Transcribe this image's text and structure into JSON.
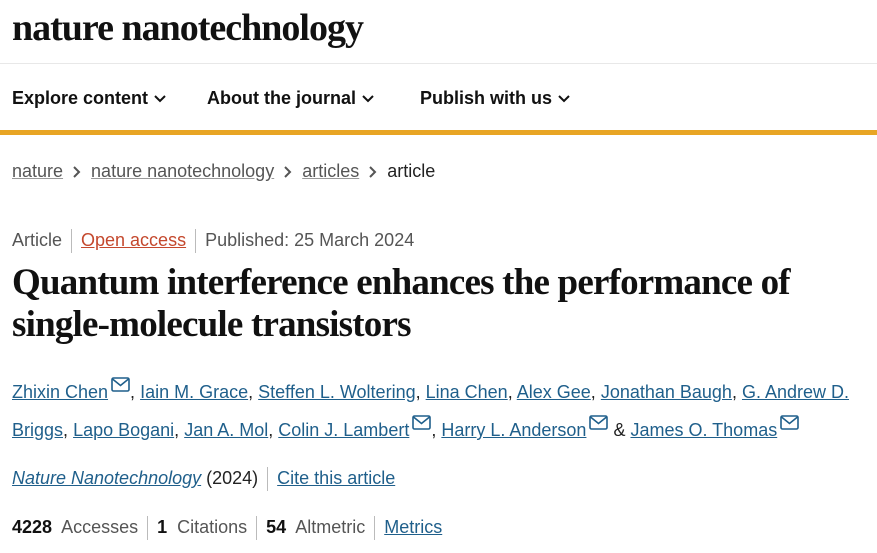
{
  "header": {
    "logo": "nature nanotechnology"
  },
  "nav": {
    "items": [
      {
        "label": "Explore content"
      },
      {
        "label": "About the journal"
      },
      {
        "label": "Publish with us"
      }
    ]
  },
  "breadcrumb": {
    "items": [
      "nature",
      "nature nanotechnology",
      "articles",
      "article"
    ]
  },
  "article_meta": {
    "type": "Article",
    "access": "Open access",
    "published": "Published: 25 March 2024"
  },
  "title": "Quantum interference enhances the performance of single-molecule transistors",
  "authors": [
    {
      "name": "Zhixin Chen",
      "mail": true
    },
    {
      "name": "Iain M. Grace",
      "mail": false
    },
    {
      "name": "Steffen L. Woltering",
      "mail": false
    },
    {
      "name": "Lina Chen",
      "mail": false
    },
    {
      "name": "Alex Gee",
      "mail": false
    },
    {
      "name": "Jonathan Baugh",
      "mail": false
    },
    {
      "name": "G. Andrew D. Briggs",
      "mail": false
    },
    {
      "name": "Lapo Bogani",
      "mail": false
    },
    {
      "name": "Jan A. Mol",
      "mail": false
    },
    {
      "name": "Colin J. Lambert",
      "mail": true
    },
    {
      "name": "Harry L. Anderson",
      "mail": true
    },
    {
      "name": "James O. Thomas",
      "mail": true
    }
  ],
  "authors_separator": ",",
  "authors_conjunction": "&",
  "journal": {
    "name": "Nature Nanotechnology",
    "year": "(2024)",
    "cite_label": "Cite this article"
  },
  "metrics": {
    "accesses_value": "4228",
    "accesses_label": "Accesses",
    "citations_value": "1",
    "citations_label": "Citations",
    "altmetric_value": "54",
    "altmetric_label": "Altmetric",
    "metrics_link": "Metrics"
  },
  "colors": {
    "accent": "#e8a524",
    "link": "#1f5f8b",
    "open_access": "#c4482d"
  }
}
